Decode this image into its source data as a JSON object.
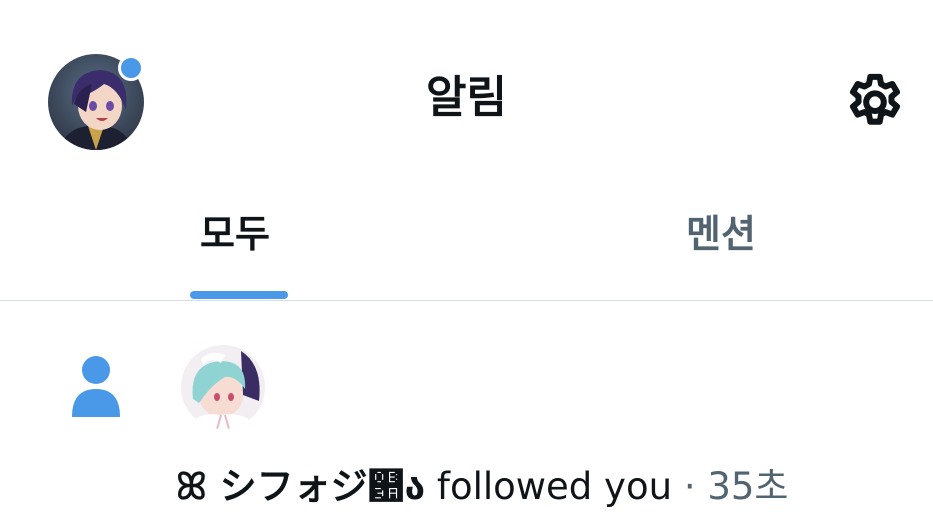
{
  "header": {
    "title": "알림",
    "avatar_icon": "user-avatar",
    "settings_icon": "gear-icon",
    "unread_dot_color": "#4a99e9"
  },
  "tabs": [
    {
      "label": "모두",
      "selected": true
    },
    {
      "label": "멘션",
      "selected": false
    }
  ],
  "accent_color": "#4a99e9",
  "notifications": [
    {
      "type": "follow",
      "icon": "person-icon",
      "user_name": "ꕤ シフォジ଺ა",
      "action": "followed you",
      "separator": "·",
      "time": "35초"
    }
  ]
}
